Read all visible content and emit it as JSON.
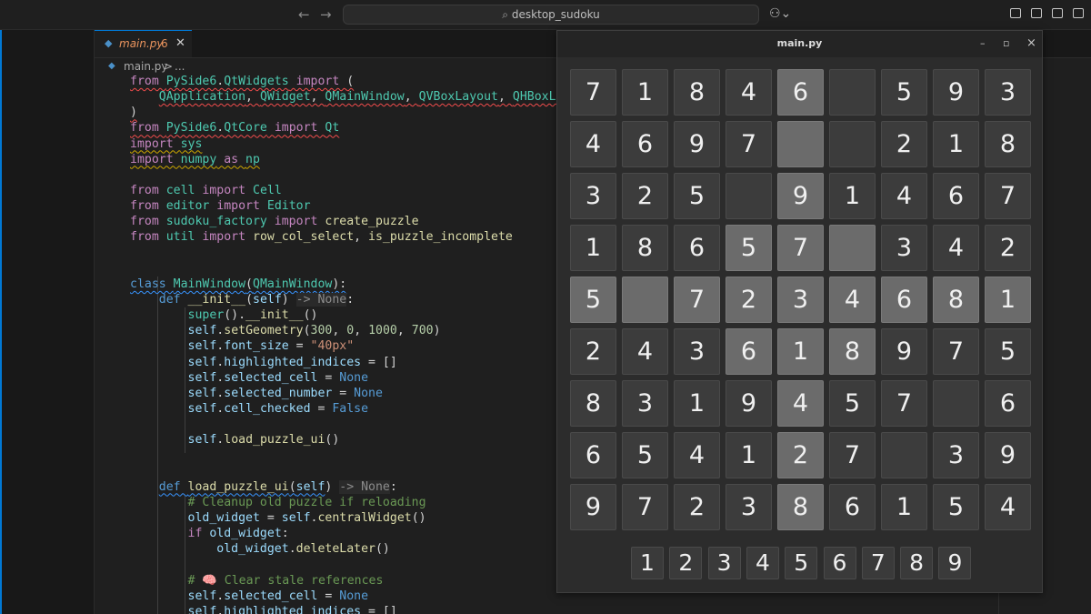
{
  "titlebar": {
    "back_icon": "arrow-left-icon",
    "forward_icon": "arrow-right-icon",
    "search_text": "desktop_sudoku",
    "copilot_icon": "copilot-icon"
  },
  "editor": {
    "tab": {
      "filename": "main.py",
      "problem_count": "6"
    },
    "breadcrumb": {
      "file": "main.py",
      "separator": ">",
      "more": "..."
    }
  },
  "sudoku": {
    "window_title": "main.py",
    "controls": {
      "minimize": "–",
      "maximize": "▫",
      "close": "×"
    },
    "grid": [
      [
        "7",
        "1",
        "8",
        "4",
        "6",
        "",
        "5",
        "9",
        "3"
      ],
      [
        "4",
        "6",
        "9",
        "7",
        "",
        "",
        "2",
        "1",
        "8"
      ],
      [
        "3",
        "2",
        "5",
        "",
        "9",
        "1",
        "4",
        "6",
        "7"
      ],
      [
        "1",
        "8",
        "6",
        "5",
        "7",
        "",
        "3",
        "4",
        "2"
      ],
      [
        "5",
        "",
        "7",
        "2",
        "3",
        "4",
        "6",
        "8",
        "1"
      ],
      [
        "2",
        "4",
        "3",
        "6",
        "1",
        "8",
        "9",
        "7",
        "5"
      ],
      [
        "8",
        "3",
        "1",
        "9",
        "4",
        "5",
        "7",
        "",
        "6"
      ],
      [
        "6",
        "5",
        "4",
        "1",
        "2",
        "7",
        "",
        "3",
        "9"
      ],
      [
        "9",
        "7",
        "2",
        "3",
        "8",
        "6",
        "1",
        "5",
        "4"
      ]
    ],
    "highlighted_cells": [
      [
        0,
        4
      ],
      [
        1,
        4
      ],
      [
        2,
        4
      ],
      [
        3,
        3
      ],
      [
        3,
        4
      ],
      [
        3,
        5
      ],
      [
        4,
        0
      ],
      [
        4,
        1
      ],
      [
        4,
        2
      ],
      [
        4,
        3
      ],
      [
        4,
        4
      ],
      [
        4,
        5
      ],
      [
        4,
        6
      ],
      [
        4,
        7
      ],
      [
        4,
        8
      ],
      [
        5,
        3
      ],
      [
        5,
        4
      ],
      [
        5,
        5
      ],
      [
        6,
        4
      ],
      [
        7,
        4
      ],
      [
        8,
        4
      ]
    ],
    "number_buttons": [
      "1",
      "2",
      "3",
      "4",
      "5",
      "6",
      "7",
      "8",
      "9"
    ]
  },
  "code_lines": [
    [
      [
        "kw",
        "from "
      ],
      [
        "cls",
        "PySide6"
      ],
      [
        "pl",
        "."
      ],
      [
        "cls",
        "QtWidgets"
      ],
      [
        "kw",
        " import "
      ],
      [
        "pl",
        "("
      ]
    ],
    [
      [
        "pl",
        "    "
      ],
      [
        "cls",
        "QApplication"
      ],
      [
        "pl",
        ", "
      ],
      [
        "cls",
        "QWidget"
      ],
      [
        "pl",
        ", "
      ],
      [
        "cls",
        "QMainWindow"
      ],
      [
        "pl",
        ", "
      ],
      [
        "cls",
        "QVBoxLayout"
      ],
      [
        "pl",
        ", "
      ],
      [
        "cls",
        "QHBoxLayou"
      ]
    ],
    [
      [
        "pl",
        ")"
      ]
    ],
    [
      [
        "kw",
        "from "
      ],
      [
        "cls",
        "PySide6"
      ],
      [
        "pl",
        "."
      ],
      [
        "cls",
        "QtCore"
      ],
      [
        "kw",
        " import "
      ],
      [
        "cls",
        "Qt"
      ]
    ],
    [
      [
        "kw",
        "import "
      ],
      [
        "cls",
        "sys"
      ]
    ],
    [
      [
        "kw",
        "import "
      ],
      [
        "cls",
        "numpy"
      ],
      [
        "kw",
        " as "
      ],
      [
        "cls",
        "np"
      ]
    ],
    [],
    [
      [
        "kw",
        "from "
      ],
      [
        "cls",
        "cell"
      ],
      [
        "kw",
        " import "
      ],
      [
        "cls",
        "Cell"
      ]
    ],
    [
      [
        "kw",
        "from "
      ],
      [
        "cls",
        "editor"
      ],
      [
        "kw",
        " import "
      ],
      [
        "cls",
        "Editor"
      ]
    ],
    [
      [
        "kw",
        "from "
      ],
      [
        "cls",
        "sudoku_factory"
      ],
      [
        "kw",
        " import "
      ],
      [
        "fn",
        "create_puzzle"
      ]
    ],
    [
      [
        "kw",
        "from "
      ],
      [
        "cls",
        "util"
      ],
      [
        "kw",
        " import "
      ],
      [
        "fn",
        "row_col_select"
      ],
      [
        "pl",
        ", "
      ],
      [
        "fn",
        "is_puzzle_incomplete"
      ]
    ],
    [],
    [],
    [
      [
        "kw2",
        "class "
      ],
      [
        "cls",
        "MainWindow"
      ],
      [
        "pl",
        "("
      ],
      [
        "cls",
        "QMainWindow"
      ],
      [
        "pl",
        "):"
      ]
    ],
    [
      [
        "pl",
        "    "
      ],
      [
        "kw2",
        "def "
      ],
      [
        "fn",
        "__init__"
      ],
      [
        "pl",
        "("
      ],
      [
        "var",
        "self"
      ],
      [
        "pl",
        ") "
      ],
      [
        "hint",
        "-> None"
      ],
      [
        "pl",
        ":"
      ]
    ],
    [
      [
        "pl",
        "        "
      ],
      [
        "cls",
        "super"
      ],
      [
        "pl",
        "()."
      ],
      [
        "fn",
        "__init__"
      ],
      [
        "pl",
        "()"
      ]
    ],
    [
      [
        "pl",
        "        "
      ],
      [
        "var",
        "self"
      ],
      [
        "pl",
        "."
      ],
      [
        "fn",
        "setGeometry"
      ],
      [
        "pl",
        "("
      ],
      [
        "num",
        "300"
      ],
      [
        "pl",
        ", "
      ],
      [
        "num",
        "0"
      ],
      [
        "pl",
        ", "
      ],
      [
        "num",
        "1000"
      ],
      [
        "pl",
        ", "
      ],
      [
        "num",
        "700"
      ],
      [
        "pl",
        ")"
      ]
    ],
    [
      [
        "pl",
        "        "
      ],
      [
        "var",
        "self"
      ],
      [
        "pl",
        "."
      ],
      [
        "var",
        "font_size"
      ],
      [
        "pl",
        " = "
      ],
      [
        "str",
        "\"40px\""
      ]
    ],
    [
      [
        "pl",
        "        "
      ],
      [
        "var",
        "self"
      ],
      [
        "pl",
        "."
      ],
      [
        "var",
        "highlighted_indices"
      ],
      [
        "pl",
        " = []"
      ]
    ],
    [
      [
        "pl",
        "        "
      ],
      [
        "var",
        "self"
      ],
      [
        "pl",
        "."
      ],
      [
        "var",
        "selected_cell"
      ],
      [
        "pl",
        " = "
      ],
      [
        "kw2",
        "None"
      ]
    ],
    [
      [
        "pl",
        "        "
      ],
      [
        "var",
        "self"
      ],
      [
        "pl",
        "."
      ],
      [
        "var",
        "selected_number"
      ],
      [
        "pl",
        " = "
      ],
      [
        "kw2",
        "None"
      ]
    ],
    [
      [
        "pl",
        "        "
      ],
      [
        "var",
        "self"
      ],
      [
        "pl",
        "."
      ],
      [
        "var",
        "cell_checked"
      ],
      [
        "pl",
        " = "
      ],
      [
        "kw2",
        "False"
      ]
    ],
    [],
    [
      [
        "pl",
        "        "
      ],
      [
        "var",
        "self"
      ],
      [
        "pl",
        "."
      ],
      [
        "fn",
        "load_puzzle_ui"
      ],
      [
        "pl",
        "()"
      ]
    ],
    [],
    [],
    [
      [
        "pl",
        "    "
      ],
      [
        "kw2",
        "def "
      ],
      [
        "fn",
        "load_puzzle_ui"
      ],
      [
        "pl",
        "("
      ],
      [
        "var",
        "self"
      ],
      [
        "pl",
        ") "
      ],
      [
        "hint",
        "-> None"
      ],
      [
        "pl",
        ":"
      ]
    ],
    [
      [
        "pl",
        "        "
      ],
      [
        "cm",
        "# Cleanup old puzzle if reloading"
      ]
    ],
    [
      [
        "pl",
        "        "
      ],
      [
        "var",
        "old_widget"
      ],
      [
        "pl",
        " = "
      ],
      [
        "var",
        "self"
      ],
      [
        "pl",
        "."
      ],
      [
        "fn",
        "centralWidget"
      ],
      [
        "pl",
        "()"
      ]
    ],
    [
      [
        "pl",
        "        "
      ],
      [
        "kw",
        "if "
      ],
      [
        "var",
        "old_widget"
      ],
      [
        "pl",
        ":"
      ]
    ],
    [
      [
        "pl",
        "            "
      ],
      [
        "var",
        "old_widget"
      ],
      [
        "pl",
        "."
      ],
      [
        "fn",
        "deleteLater"
      ],
      [
        "pl",
        "()"
      ]
    ],
    [],
    [
      [
        "pl",
        "        "
      ],
      [
        "cm",
        "# 🧠 Clear stale references"
      ]
    ],
    [
      [
        "pl",
        "        "
      ],
      [
        "var",
        "self"
      ],
      [
        "pl",
        "."
      ],
      [
        "var",
        "selected_cell"
      ],
      [
        "pl",
        " = "
      ],
      [
        "kw2",
        "None"
      ]
    ],
    [
      [
        "pl",
        "        "
      ],
      [
        "var",
        "self"
      ],
      [
        "pl",
        "."
      ],
      [
        "var",
        "highlighted_indices"
      ],
      [
        "pl",
        " = []"
      ]
    ]
  ],
  "diagnostics": {
    "0": "red",
    "1": "red",
    "2": "red",
    "3": "red",
    "4": "yellow",
    "5": "yellow",
    "13": "blue",
    "26": "blue"
  }
}
